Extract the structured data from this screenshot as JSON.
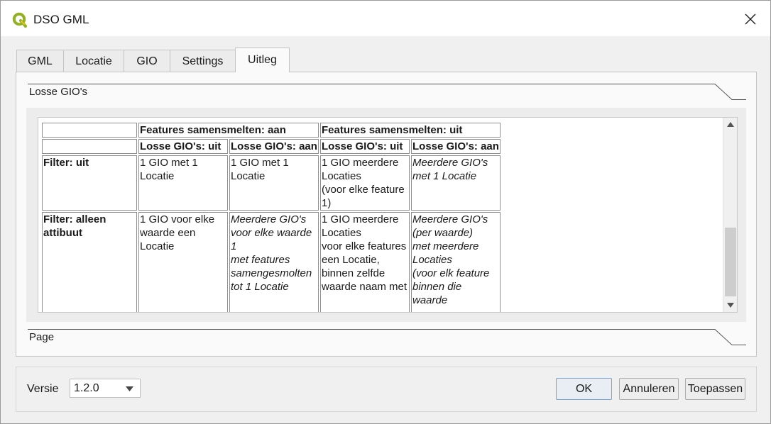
{
  "window": {
    "title": "DSO GML"
  },
  "tabs": [
    {
      "label": "GML"
    },
    {
      "label": "Locatie"
    },
    {
      "label": "GIO"
    },
    {
      "label": "Settings"
    },
    {
      "label": "Uitleg",
      "active": true
    }
  ],
  "groups": {
    "losse": "Losse GIO's",
    "page": "Page"
  },
  "table": {
    "header1": [
      "",
      "Features samensmelten: aan",
      "Features samensmelten: uit"
    ],
    "header2": [
      "",
      "Losse GIO's: uit",
      "Losse GIO's: aan",
      "Losse GIO's: uit",
      "Losse GIO's: aan"
    ],
    "row1": {
      "label": "Filter: uit",
      "c1": "1 GIO met 1 Locatie",
      "c2": "1 GIO met 1 Locatie",
      "c3_l1": "1 GIO meerdere Locaties",
      "c3_l2": "(voor elke feature 1)",
      "c4": "Meerdere GIO's met 1 Locatie"
    },
    "row2": {
      "label": "Filter: alleen attibuut",
      "c1": "1 GIO voor elke waarde een Locatie",
      "c2_l1": "Meerdere GIO's voor elke waarde 1",
      "c2_l2": "met features samengesmolten tot 1 Locatie",
      "c3_l1": "1 GIO meerdere Locaties",
      "c3_l2": "voor elke features een Locatie, binnen zelfde waarde naam met",
      "c4_l1": "Meerdere GIO's",
      "c4_l2": "(per waarde)",
      "c4_l3": "met meerdere Locaties",
      "c4_l4": "(voor elk feature binnen die waarde"
    }
  },
  "footer": {
    "versie_label": "Versie",
    "versie_value": "1.2.0",
    "ok": "OK",
    "annuleren": "Annuleren",
    "toepassen": "Toepassen"
  },
  "colors": {
    "accent": "#7ba4cf",
    "qgis_green": "#93b023",
    "qgis_yellow": "#f0c419"
  }
}
